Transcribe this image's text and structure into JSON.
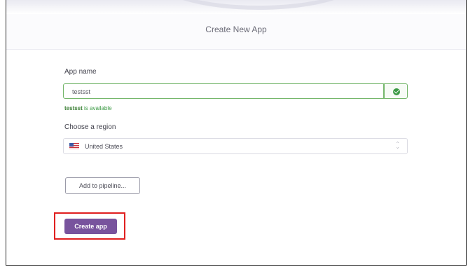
{
  "header": {
    "title": "Create New App"
  },
  "form": {
    "app_name_label": "App name",
    "app_name_value": "testsst",
    "availability_name": "testsst",
    "availability_suffix": " is available",
    "region_label": "Choose a region",
    "region_value": "United States",
    "region_flag_icon": "us-flag-icon",
    "pipeline_button": "Add to pipeline...",
    "create_button": "Create app"
  },
  "colors": {
    "accent": "#78539d",
    "success": "#3c9a45",
    "highlight": "#e01f1f"
  }
}
